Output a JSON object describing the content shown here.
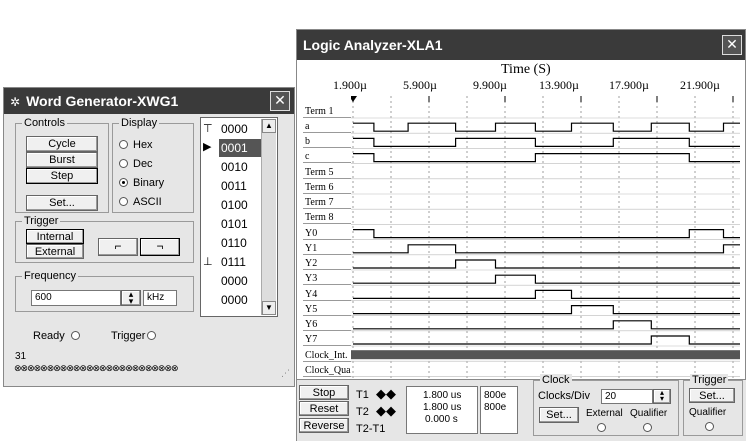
{
  "word_generator": {
    "title": "Word Generator-XWG1",
    "close": "✕",
    "controls": {
      "caption": "Controls",
      "cycle": "Cycle",
      "burst": "Burst",
      "step": "Step",
      "set": "Set..."
    },
    "display": {
      "caption": "Display",
      "options": [
        "Hex",
        "Dec",
        "Binary",
        "ASCII"
      ],
      "selected": "Binary"
    },
    "trigger": {
      "caption": "Trigger",
      "internal": "Internal",
      "external": "External",
      "rise_icon": "rising-edge-icon",
      "fall_icon": "falling-edge-icon"
    },
    "frequency": {
      "caption": "Frequency",
      "value": "600",
      "unit": "kHz"
    },
    "words": [
      "0000",
      "0001",
      "0010",
      "0011",
      "0100",
      "0101",
      "0110",
      "0111",
      "0000",
      "0000"
    ],
    "selected_index": 1,
    "ready": "Ready",
    "trigger_status": "Trigger",
    "address": "31",
    "bits": "⊗⊗⊗⊗⊗⊗⊗⊗⊗⊗⊗⊗⊗⊗⊗⊗⊗⊗⊗⊗⊗⊗⊗⊗⊗"
  },
  "logic_analyzer": {
    "title": "Logic Analyzer-XLA1",
    "close": "✕",
    "time_label": "Time (S)",
    "ticks": [
      "1.900µ",
      "5.900µ",
      "9.900µ",
      "13.900µ",
      "17.900µ",
      "21.900µ"
    ],
    "signals": [
      "Term 1",
      "a",
      "b",
      "c",
      "Term 5",
      "Term 6",
      "Term 7",
      "Term 8",
      "Y0",
      "Y1",
      "Y2",
      "Y3",
      "Y4",
      "Y5",
      "Y6",
      "Y7",
      "Clock_Int.",
      "Clock_Qua"
    ],
    "buttons": {
      "stop": "Stop",
      "reset": "Reset",
      "reverse": "Reverse"
    },
    "cursors": {
      "t1": "T1",
      "t2": "T2",
      "t2t1": "T2-T1",
      "t1_time": "1.800 us",
      "t2_time": "1.800 us",
      "diff_time": "0.000 s",
      "t1_value": "800e",
      "t2_value": "800e"
    },
    "clock": {
      "caption": "Clock",
      "clocks_div_label": "Clocks/Div",
      "clocks_div": "20",
      "set": "Set...",
      "external": "External",
      "qualifier": "Qualifier"
    },
    "trigger": {
      "caption": "Trigger",
      "set": "Set...",
      "qualifier": "Qualifier"
    }
  },
  "chart_data": {
    "type": "line",
    "title": "",
    "xlabel": "Time (S)",
    "x_ticks": [
      "1.900µ",
      "5.900µ",
      "9.900µ",
      "13.900µ",
      "17.900µ",
      "21.900µ"
    ],
    "xlim": [
      1.9,
      21.9
    ],
    "series": [
      {
        "name": "a",
        "transitions": [
          [
            1.9,
            1
          ],
          [
            3.0,
            0
          ],
          [
            4.8,
            1
          ],
          [
            7.3,
            0
          ],
          [
            9.4,
            1
          ],
          [
            11.5,
            0
          ],
          [
            13.4,
            1
          ],
          [
            15.6,
            0
          ],
          [
            17.6,
            1
          ],
          [
            19.6,
            0
          ],
          [
            21.4,
            1
          ],
          [
            22.3,
            1
          ]
        ]
      },
      {
        "name": "b",
        "transitions": [
          [
            1.9,
            1
          ],
          [
            3.0,
            0
          ],
          [
            7.3,
            1
          ],
          [
            11.5,
            0
          ],
          [
            15.6,
            1
          ],
          [
            19.6,
            0
          ],
          [
            22.3,
            0
          ]
        ]
      },
      {
        "name": "c",
        "transitions": [
          [
            1.9,
            1
          ],
          [
            3.0,
            0
          ],
          [
            11.5,
            1
          ],
          [
            19.6,
            0
          ],
          [
            22.3,
            0
          ]
        ]
      },
      {
        "name": "Y0",
        "transitions": [
          [
            1.9,
            1
          ],
          [
            3.0,
            0
          ],
          [
            19.6,
            1
          ],
          [
            21.4,
            0
          ],
          [
            22.3,
            0
          ]
        ]
      },
      {
        "name": "Y1",
        "transitions": [
          [
            1.9,
            0
          ],
          [
            4.8,
            1
          ],
          [
            7.3,
            0
          ],
          [
            21.4,
            1
          ],
          [
            22.3,
            1
          ]
        ]
      },
      {
        "name": "Y2",
        "transitions": [
          [
            1.9,
            0
          ],
          [
            7.3,
            1
          ],
          [
            9.4,
            0
          ],
          [
            22.3,
            0
          ]
        ]
      },
      {
        "name": "Y3",
        "transitions": [
          [
            1.9,
            0
          ],
          [
            9.4,
            1
          ],
          [
            11.5,
            0
          ],
          [
            22.3,
            0
          ]
        ]
      },
      {
        "name": "Y4",
        "transitions": [
          [
            1.9,
            0
          ],
          [
            11.5,
            1
          ],
          [
            13.4,
            0
          ],
          [
            22.3,
            0
          ]
        ]
      },
      {
        "name": "Y5",
        "transitions": [
          [
            1.9,
            0
          ],
          [
            13.4,
            1
          ],
          [
            15.6,
            0
          ],
          [
            22.3,
            0
          ]
        ]
      },
      {
        "name": "Y6",
        "transitions": [
          [
            1.9,
            0
          ],
          [
            15.6,
            1
          ],
          [
            17.6,
            0
          ],
          [
            22.3,
            0
          ]
        ]
      },
      {
        "name": "Y7",
        "transitions": [
          [
            1.9,
            0
          ],
          [
            17.6,
            1
          ],
          [
            19.6,
            0
          ],
          [
            22.3,
            0
          ]
        ]
      }
    ]
  },
  "colors": {
    "titlebar": "#3a3a3a",
    "selected_word": "#555555",
    "clock_bar": "#555555"
  }
}
